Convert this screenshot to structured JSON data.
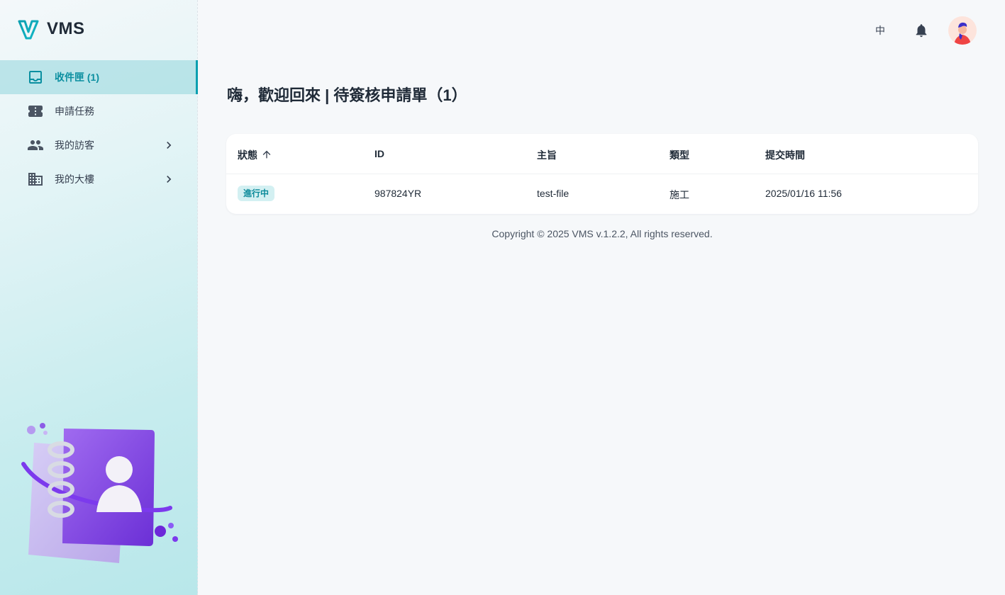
{
  "brand": {
    "name": "VMS",
    "accent": "#0b9fb0"
  },
  "sidebar": {
    "items": [
      {
        "label": "收件匣 (1)",
        "icon": "inbox-icon",
        "active": true
      },
      {
        "label": "申請任務",
        "icon": "ticket-icon",
        "active": false
      },
      {
        "label": "我的訪客",
        "icon": "people-icon",
        "active": false,
        "expandable": true
      },
      {
        "label": "我的大樓",
        "icon": "building-icon",
        "active": false,
        "expandable": true
      }
    ]
  },
  "topbar": {
    "language": "中",
    "notification_icon": "bell-icon",
    "avatar_icon": "user-avatar"
  },
  "page": {
    "title": "嗨，歡迎回來 | 待簽核申請單（1）"
  },
  "table": {
    "headers": {
      "status": "狀態",
      "id": "ID",
      "subject": "主旨",
      "type": "類型",
      "submitted": "提交時間"
    },
    "sort_icon": "arrow-up-icon",
    "rows": [
      {
        "status": "進行中",
        "id": "987824YR",
        "subject": "test-file",
        "type": "施工",
        "submitted": "2025/01/16 11:56"
      }
    ]
  },
  "footer": {
    "text": "Copyright © 2025 VMS v.1.2.2, All rights reserved."
  }
}
